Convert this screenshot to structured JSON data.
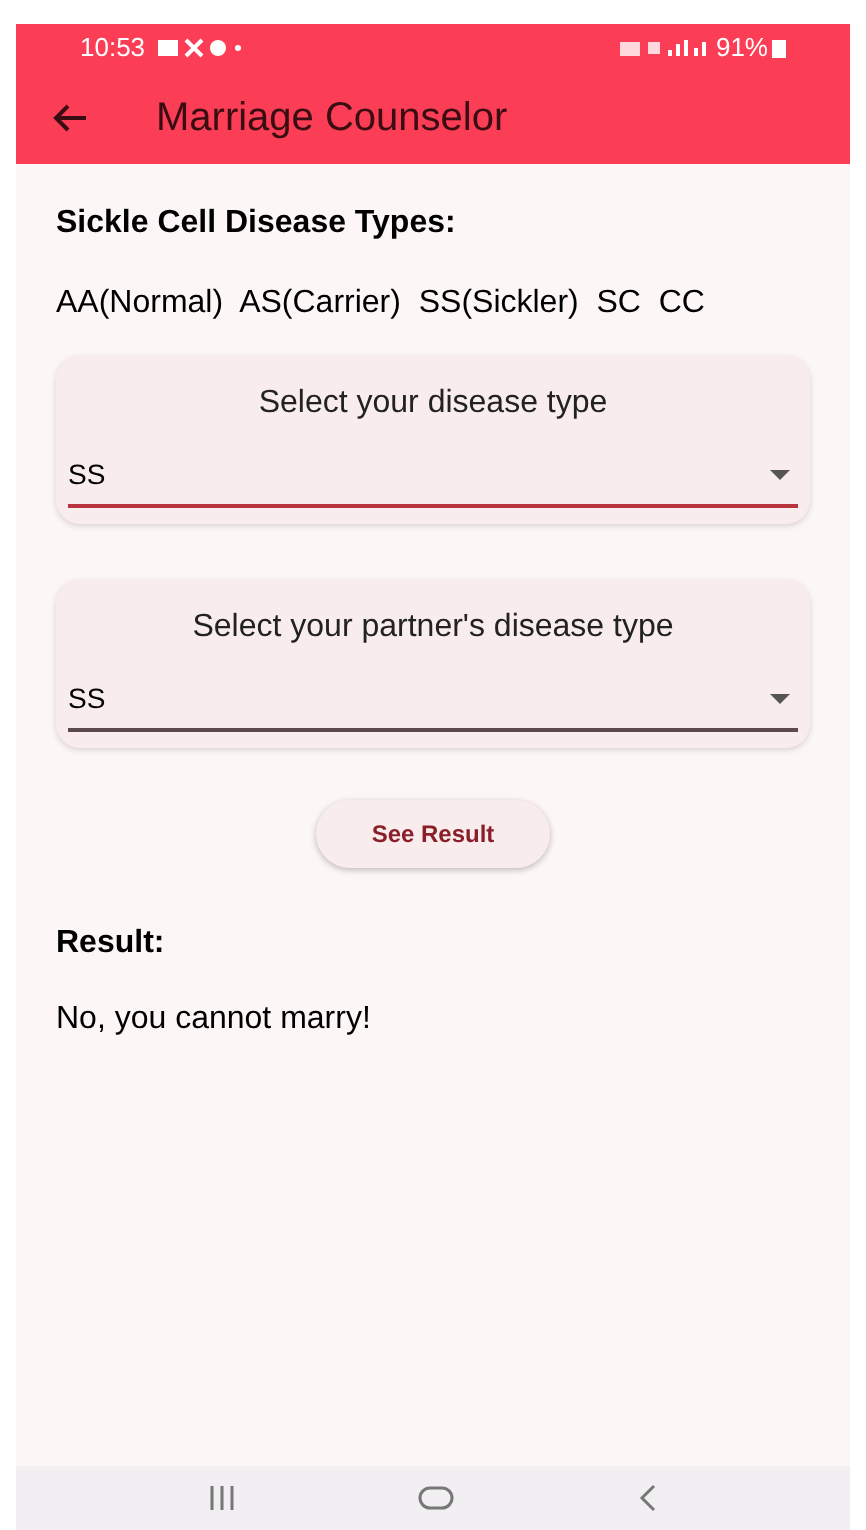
{
  "status_bar": {
    "time": "10:53",
    "battery": "91%"
  },
  "app_bar": {
    "title": "Marriage Counselor"
  },
  "types_heading": "Sickle Cell Disease Types:",
  "types_text": "AA(Normal)  AS(Carrier)  SS(Sickler)  SC  CC",
  "dropdowns": [
    {
      "label": "Select your disease type",
      "value": "SS",
      "focused": true
    },
    {
      "label": "Select your partner's disease type",
      "value": "SS",
      "focused": false
    }
  ],
  "button": "See Result",
  "result_heading": "Result:",
  "result_text": "No, you cannot marry!"
}
